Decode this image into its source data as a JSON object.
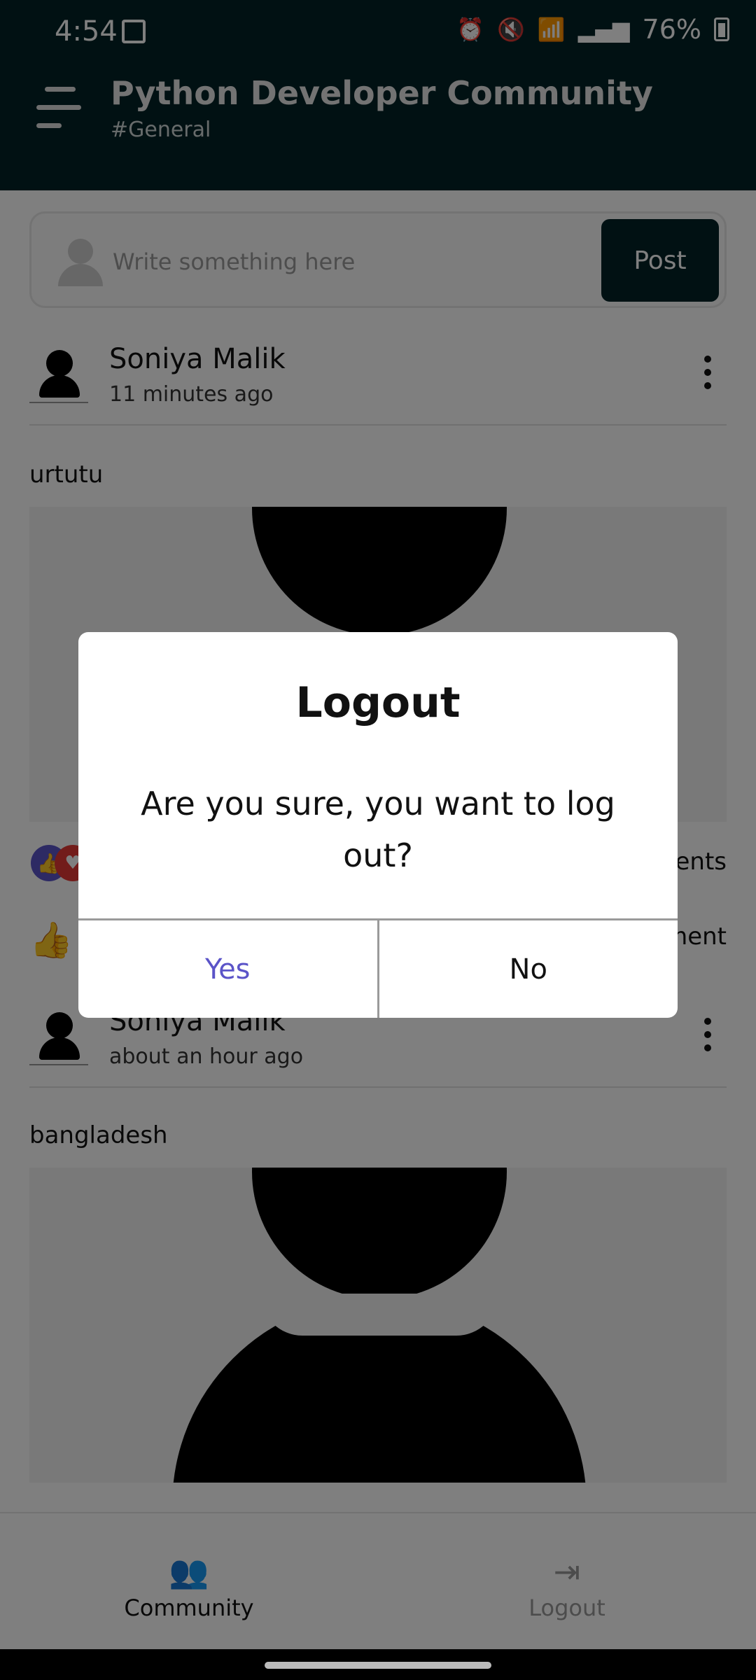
{
  "status_bar": {
    "time": "4:54",
    "battery": "76%",
    "icons": [
      "image-icon",
      "alarm-icon",
      "mute-icon",
      "wifi-icon",
      "signal-icon",
      "battery-icon"
    ]
  },
  "app_bar": {
    "title": "Python Developer Community",
    "channel": "#General"
  },
  "composer": {
    "placeholder": "Write something here",
    "post_label": "Post"
  },
  "posts": [
    {
      "author": "Soniya Malik",
      "time_ago": "11 minutes ago",
      "text": "urtutu",
      "reactions_right": "ents",
      "actions_right": "ment"
    },
    {
      "author": "Soniya Malik",
      "time_ago": "about an hour ago",
      "text": "bangladesh"
    }
  ],
  "bottom_nav": {
    "community_label": "Community",
    "logout_label": "Logout"
  },
  "dialog": {
    "title": "Logout",
    "message": "Are you sure, you want to log out?",
    "yes_label": "Yes",
    "no_label": "No"
  },
  "colors": {
    "primary_dark": "#032326",
    "accent": "#5b54c8",
    "heart": "#e53935"
  }
}
